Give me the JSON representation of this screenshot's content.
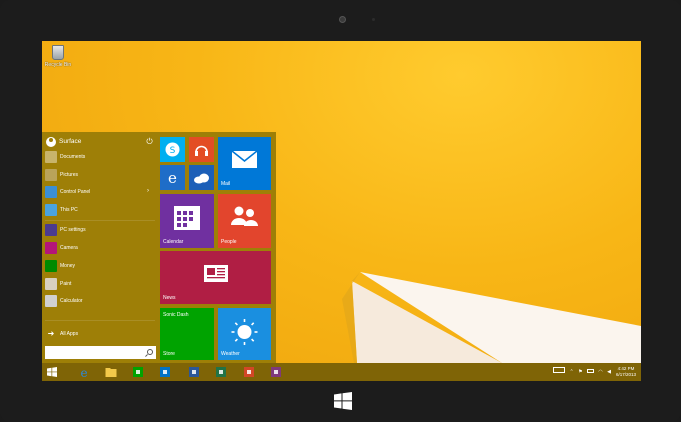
{
  "desktop": {
    "icons": [
      {
        "label": "Recycle Bin",
        "icon": "recycle-bin-icon"
      }
    ]
  },
  "start_menu": {
    "user": {
      "name": "Surface",
      "icon": "user-avatar",
      "power_icon": "power-icon"
    },
    "items": [
      {
        "label": "Documents",
        "icon": "documents-icon",
        "color": "#c8b46b",
        "has_arrow": false
      },
      {
        "label": "Pictures",
        "icon": "pictures-icon",
        "color": "#b9a35a",
        "has_arrow": false
      },
      {
        "label": "Control Panel",
        "icon": "control-panel-icon",
        "color": "#3b8fd4",
        "has_arrow": true
      },
      {
        "label": "This PC",
        "icon": "this-pc-icon",
        "color": "#4aa3df",
        "has_arrow": false
      },
      {
        "label": "PC settings",
        "icon": "pc-settings-icon",
        "color": "#4b3b8f",
        "has_arrow": false
      },
      {
        "label": "Camera",
        "icon": "camera-icon",
        "color": "#b4157a",
        "has_arrow": false
      },
      {
        "label": "Money",
        "icon": "money-icon",
        "color": "#008a00",
        "has_arrow": false
      },
      {
        "label": "Paint",
        "icon": "paint-icon",
        "color": "#d8d0c0",
        "has_arrow": false
      },
      {
        "label": "Calculator",
        "icon": "calculator-icon",
        "color": "#d0d0d0",
        "has_arrow": false
      }
    ],
    "all_apps": {
      "label": "All Apps",
      "icon": "arrow-right-icon"
    },
    "search": {
      "placeholder": "",
      "icon": "search-icon"
    },
    "tiles": [
      {
        "id": "skype",
        "label": "",
        "icon": "skype-icon",
        "color": "#00aff0"
      },
      {
        "id": "music",
        "label": "",
        "icon": "headphones-icon",
        "color": "#e34d24"
      },
      {
        "id": "ie",
        "label": "",
        "icon": "internet-explorer-icon",
        "color": "#1e6dc8"
      },
      {
        "id": "onedrive",
        "label": "",
        "icon": "cloud-icon",
        "color": "#1c5fb8"
      },
      {
        "id": "mail",
        "label": "Mail",
        "icon": "mail-icon",
        "color": "#0078d7"
      },
      {
        "id": "calendar",
        "label": "Calendar",
        "icon": "calendar-icon",
        "color": "#7030a0"
      },
      {
        "id": "people",
        "label": "People",
        "icon": "people-icon",
        "color": "#e2452d"
      },
      {
        "id": "news",
        "label": "News",
        "icon": "news-icon",
        "color": "#b01e44"
      },
      {
        "id": "store",
        "label": "Store",
        "sublabel": "Sonic Dash",
        "icon": "store-icon",
        "color": "#00a300"
      },
      {
        "id": "weather",
        "label": "Weather",
        "icon": "sun-icon",
        "color": "#1a8fe0"
      }
    ]
  },
  "taskbar": {
    "buttons": [
      {
        "name": "start-button",
        "icon": "windows-logo-icon",
        "color": "#ffffff"
      },
      {
        "name": "ie-taskbar-button",
        "icon": "internet-explorer-icon",
        "color": "#2b88d8"
      },
      {
        "name": "file-explorer-taskbar-button",
        "icon": "folder-icon",
        "color": "#f3c94a"
      },
      {
        "name": "store-taskbar-button",
        "icon": "store-icon",
        "color": "#00a300"
      },
      {
        "name": "outlook-taskbar-button",
        "icon": "outlook-icon",
        "color": "#0072c6"
      },
      {
        "name": "word-taskbar-button",
        "icon": "word-icon",
        "color": "#2b579a"
      },
      {
        "name": "excel-taskbar-button",
        "icon": "excel-icon",
        "color": "#217346"
      },
      {
        "name": "powerpoint-taskbar-button",
        "icon": "powerpoint-icon",
        "color": "#d24726"
      },
      {
        "name": "onenote-taskbar-button",
        "icon": "onenote-icon",
        "color": "#80397b"
      }
    ],
    "tray_icons": [
      "keyboard-icon",
      "chevron-up-icon",
      "flag-icon",
      "battery-icon",
      "wifi-icon",
      "volume-icon"
    ],
    "clock": {
      "time": "4:42 PM",
      "date": "6/17/2013"
    }
  },
  "device": {
    "windows_button_icon": "windows-logo-icon"
  },
  "colors": {
    "accent": "#9e7f07",
    "taskbar": "#7f6406",
    "wallpaper": "#f8b616"
  }
}
